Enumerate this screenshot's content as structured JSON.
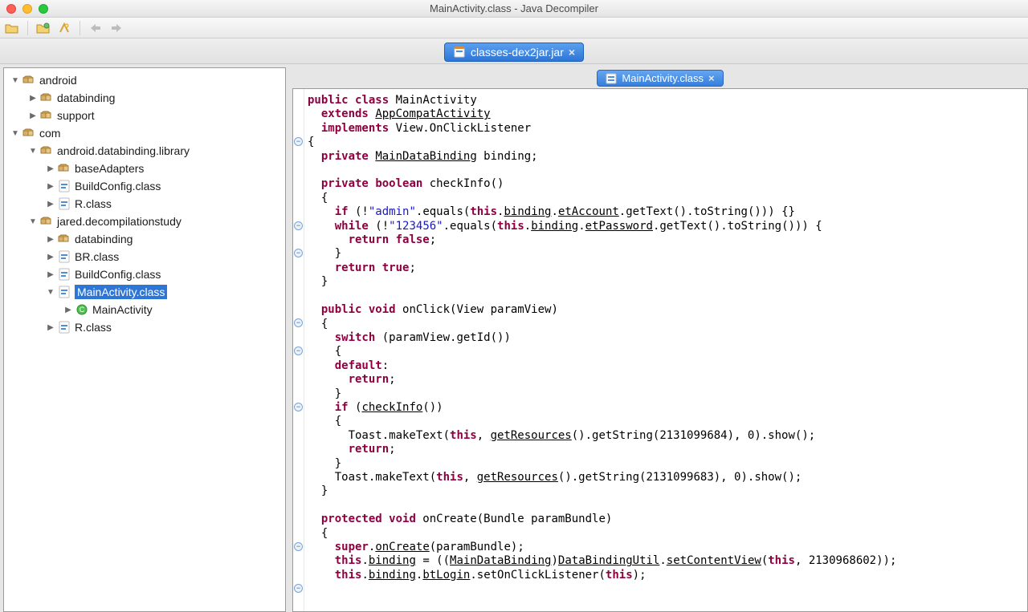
{
  "window": {
    "title": "MainActivity.class - Java Decompiler"
  },
  "main_tab": {
    "label": "classes-dex2jar.jar"
  },
  "editor_tab": {
    "label": "MainActivity.class"
  },
  "tree": [
    {
      "depth": 0,
      "disclosure": "down",
      "icon": "pkg",
      "label": "android"
    },
    {
      "depth": 1,
      "disclosure": "right",
      "icon": "pkg",
      "label": "databinding"
    },
    {
      "depth": 1,
      "disclosure": "right",
      "icon": "pkg",
      "label": "support"
    },
    {
      "depth": 0,
      "disclosure": "down",
      "icon": "pkg",
      "label": "com"
    },
    {
      "depth": 1,
      "disclosure": "down",
      "icon": "pkg",
      "label": "android.databinding.library"
    },
    {
      "depth": 2,
      "disclosure": "right",
      "icon": "pkg",
      "label": "baseAdapters"
    },
    {
      "depth": 2,
      "disclosure": "right",
      "icon": "cls",
      "label": "BuildConfig.class"
    },
    {
      "depth": 2,
      "disclosure": "right",
      "icon": "cls",
      "label": "R.class"
    },
    {
      "depth": 1,
      "disclosure": "down",
      "icon": "pkg",
      "label": "jared.decompilationstudy"
    },
    {
      "depth": 2,
      "disclosure": "right",
      "icon": "pkg",
      "label": "databinding"
    },
    {
      "depth": 2,
      "disclosure": "right",
      "icon": "cls",
      "label": "BR.class"
    },
    {
      "depth": 2,
      "disclosure": "right",
      "icon": "cls",
      "label": "BuildConfig.class"
    },
    {
      "depth": 2,
      "disclosure": "down",
      "icon": "cls",
      "label": "MainActivity.class",
      "selected": true
    },
    {
      "depth": 3,
      "disclosure": "right",
      "icon": "circ",
      "label": "MainActivity"
    },
    {
      "depth": 2,
      "disclosure": "right",
      "icon": "cls",
      "label": "R.class"
    }
  ],
  "fold_lines": [
    4,
    10,
    12,
    17,
    19,
    23,
    33,
    36
  ],
  "code_tokens": [
    [
      [
        "kw",
        "public"
      ],
      [
        "",
        " "
      ],
      [
        "kw",
        "class"
      ],
      [
        "",
        " MainActivity"
      ]
    ],
    [
      [
        "",
        "  "
      ],
      [
        "kw",
        "extends"
      ],
      [
        "",
        " "
      ],
      [
        "lnk",
        "AppCompatActivity"
      ]
    ],
    [
      [
        "",
        "  "
      ],
      [
        "kw",
        "implements"
      ],
      [
        "",
        " View.OnClickListener"
      ]
    ],
    [
      [
        "",
        "{"
      ]
    ],
    [
      [
        "",
        "  "
      ],
      [
        "kw",
        "private"
      ],
      [
        "",
        " "
      ],
      [
        "lnk",
        "MainDataBinding"
      ],
      [
        "",
        " binding;"
      ]
    ],
    [
      [
        "",
        "  "
      ]
    ],
    [
      [
        "",
        "  "
      ],
      [
        "kw",
        "private"
      ],
      [
        "",
        " "
      ],
      [
        "kw",
        "boolean"
      ],
      [
        "",
        " checkInfo()"
      ]
    ],
    [
      [
        "",
        "  {"
      ]
    ],
    [
      [
        "",
        "    "
      ],
      [
        "kw",
        "if"
      ],
      [
        "",
        " (!"
      ],
      [
        "str",
        "\"admin\""
      ],
      [
        "",
        ".equals("
      ],
      [
        "kw",
        "this"
      ],
      [
        "",
        "."
      ],
      [
        "lnk",
        "binding"
      ],
      [
        "",
        "."
      ],
      [
        "lnk",
        "etAccount"
      ],
      [
        "",
        ".getText().toString())) {}"
      ]
    ],
    [
      [
        "",
        "    "
      ],
      [
        "kw",
        "while"
      ],
      [
        "",
        " (!"
      ],
      [
        "str",
        "\"123456\""
      ],
      [
        "",
        ".equals("
      ],
      [
        "kw",
        "this"
      ],
      [
        "",
        "."
      ],
      [
        "lnk",
        "binding"
      ],
      [
        "",
        "."
      ],
      [
        "lnk",
        "etPassword"
      ],
      [
        "",
        ".getText().toString())) {"
      ]
    ],
    [
      [
        "",
        "      "
      ],
      [
        "kw",
        "return"
      ],
      [
        "",
        " "
      ],
      [
        "kw",
        "false"
      ],
      [
        "",
        ";"
      ]
    ],
    [
      [
        "",
        "    }"
      ]
    ],
    [
      [
        "",
        "    "
      ],
      [
        "kw",
        "return"
      ],
      [
        "",
        " "
      ],
      [
        "kw",
        "true"
      ],
      [
        "",
        ";"
      ]
    ],
    [
      [
        "",
        "  }"
      ]
    ],
    [
      [
        "",
        "  "
      ]
    ],
    [
      [
        "",
        "  "
      ],
      [
        "kw",
        "public"
      ],
      [
        "",
        " "
      ],
      [
        "kw",
        "void"
      ],
      [
        "",
        " onClick(View paramView)"
      ]
    ],
    [
      [
        "",
        "  {"
      ]
    ],
    [
      [
        "",
        "    "
      ],
      [
        "kw",
        "switch"
      ],
      [
        "",
        " (paramView.getId())"
      ]
    ],
    [
      [
        "",
        "    {"
      ]
    ],
    [
      [
        "",
        "    "
      ],
      [
        "kw",
        "default"
      ],
      [
        "",
        ": "
      ]
    ],
    [
      [
        "",
        "      "
      ],
      [
        "kw",
        "return"
      ],
      [
        "",
        ";"
      ]
    ],
    [
      [
        "",
        "    }"
      ]
    ],
    [
      [
        "",
        "    "
      ],
      [
        "kw",
        "if"
      ],
      [
        "",
        " ("
      ],
      [
        "lnk",
        "checkInfo"
      ],
      [
        "",
        "())"
      ]
    ],
    [
      [
        "",
        "    {"
      ]
    ],
    [
      [
        "",
        "      Toast.makeText("
      ],
      [
        "kw",
        "this"
      ],
      [
        "",
        ", "
      ],
      [
        "lnk",
        "getResources"
      ],
      [
        "",
        "().getString(2131099684), 0).show();"
      ]
    ],
    [
      [
        "",
        "      "
      ],
      [
        "kw",
        "return"
      ],
      [
        "",
        ";"
      ]
    ],
    [
      [
        "",
        "    }"
      ]
    ],
    [
      [
        "",
        "    Toast.makeText("
      ],
      [
        "kw",
        "this"
      ],
      [
        "",
        ", "
      ],
      [
        "lnk",
        "getResources"
      ],
      [
        "",
        "().getString(2131099683), 0).show();"
      ]
    ],
    [
      [
        "",
        "  }"
      ]
    ],
    [
      [
        "",
        "  "
      ]
    ],
    [
      [
        "",
        "  "
      ],
      [
        "kw",
        "protected"
      ],
      [
        "",
        " "
      ],
      [
        "kw",
        "void"
      ],
      [
        "",
        " onCreate(Bundle paramBundle)"
      ]
    ],
    [
      [
        "",
        "  {"
      ]
    ],
    [
      [
        "",
        "    "
      ],
      [
        "kw",
        "super"
      ],
      [
        "",
        "."
      ],
      [
        "lnk",
        "onCreate"
      ],
      [
        "",
        "(paramBundle);"
      ]
    ],
    [
      [
        "",
        "    "
      ],
      [
        "kw",
        "this"
      ],
      [
        "",
        "."
      ],
      [
        "lnk",
        "binding"
      ],
      [
        "",
        " = (("
      ],
      [
        "lnk",
        "MainDataBinding"
      ],
      [
        "",
        ")"
      ],
      [
        "lnk",
        "DataBindingUtil"
      ],
      [
        "",
        "."
      ],
      [
        "lnk",
        "setContentView"
      ],
      [
        "",
        "("
      ],
      [
        "kw",
        "this"
      ],
      [
        "",
        ", 2130968602));"
      ]
    ],
    [
      [
        "",
        "    "
      ],
      [
        "kw",
        "this"
      ],
      [
        "",
        "."
      ],
      [
        "lnk",
        "binding"
      ],
      [
        "",
        "."
      ],
      [
        "lnk",
        "btLogin"
      ],
      [
        "",
        ".setOnClickListener("
      ],
      [
        "kw",
        "this"
      ],
      [
        "",
        ");"
      ]
    ]
  ]
}
